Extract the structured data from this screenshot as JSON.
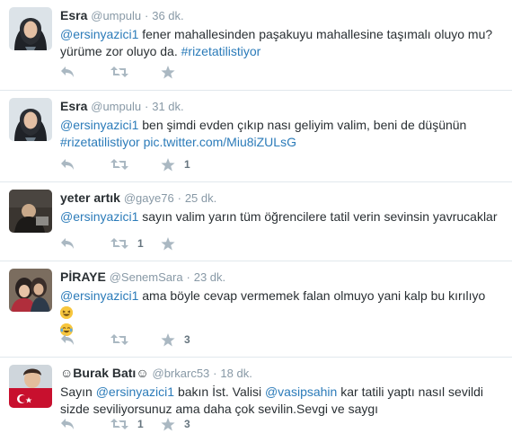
{
  "tweets": [
    {
      "fullname": "Esra",
      "username": "@umpulu",
      "separator": "·",
      "time": "36 dk.",
      "parts": [
        {
          "t": "@ersinyazici1",
          "link": true
        },
        {
          "t": " fener mahallesinden paşakuyu mahallesine taşımalı oluyo mu? yürüme zor oluyo da. ",
          "link": false
        },
        {
          "t": "#rizetatilistiyor",
          "link": true
        }
      ],
      "retweet_count": "",
      "favorite_count": ""
    },
    {
      "fullname": "Esra",
      "username": "@umpulu",
      "separator": "·",
      "time": "31 dk.",
      "parts": [
        {
          "t": "@ersinyazici1",
          "link": true
        },
        {
          "t": " ben şimdi evden çıkıp nası geliyim valim, beni de düşünün ",
          "link": false
        },
        {
          "t": "#rizetatilistiyor",
          "link": true
        },
        {
          "t": " ",
          "link": false
        },
        {
          "t": "pic.twitter.com/Miu8iZULsG",
          "link": true
        }
      ],
      "retweet_count": "",
      "favorite_count": "1"
    },
    {
      "fullname": "yeter artık",
      "username": "@gaye76",
      "separator": "·",
      "time": "25 dk.",
      "parts": [
        {
          "t": "@ersinyazici1",
          "link": true
        },
        {
          "t": " sayın valim yarın tüm öğrencilere tatil verin sevinsin yavrucaklar",
          "link": false
        }
      ],
      "retweet_count": "1",
      "favorite_count": ""
    },
    {
      "fullname": "PİRAYE",
      "username": "@SenemSara",
      "separator": "·",
      "time": "23 dk.",
      "parts": [
        {
          "t": "@ersinyazici1",
          "link": true
        },
        {
          "t": " ama böyle cevap vermemek falan olmuyo yani kalp bu kırılıyo ",
          "link": false
        }
      ],
      "emoji": [
        "grinning-squint-emoji",
        "tears-of-joy-emoji"
      ],
      "retweet_count": "",
      "favorite_count": "3"
    },
    {
      "fullname": "☺Burak Batı☺",
      "username": "@brkarc53",
      "separator": "·",
      "time": "18 dk.",
      "parts": [
        {
          "t": "Sayın ",
          "link": false
        },
        {
          "t": "@ersinyazici1",
          "link": true
        },
        {
          "t": "  bakın İst. Valisi ",
          "link": false
        },
        {
          "t": "@vasipsahin",
          "link": true
        },
        {
          "t": "  kar tatili yaptı nasıl sevildi sizde seviliyorsunuz ama daha çok sevilin.Sevgi ve saygı",
          "link": false
        }
      ],
      "retweet_count": "1",
      "favorite_count": "3"
    }
  ],
  "colors": {
    "link": "#2b7bb9",
    "muted": "#8899a6",
    "icon": "#aab8c2",
    "border": "#e1e8ed"
  }
}
